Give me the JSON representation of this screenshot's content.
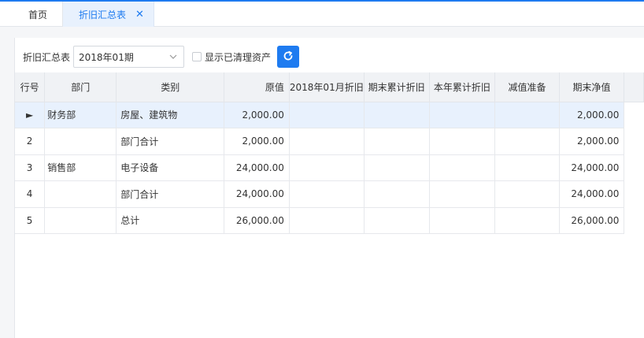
{
  "tabs": {
    "home": "首页",
    "active": "折旧汇总表",
    "close": "✕"
  },
  "toolbar": {
    "label": "折旧汇总表",
    "period": "2018年01期",
    "show_cleared_label": "显示已清理资产"
  },
  "table": {
    "headers": {
      "no": "行号",
      "dept": "部门",
      "category": "类别",
      "original": "原值",
      "period_dep": "2018年01月折旧",
      "end_accum": "期末累计折旧",
      "year_accum": "本年累计折旧",
      "impairment": "减值准备",
      "net": "期末净值"
    },
    "rows": [
      {
        "no": "►",
        "dept": "财务部",
        "category": "房屋、建筑物",
        "original": "2,000.00",
        "period_dep": "",
        "end_accum": "",
        "year_accum": "",
        "impairment": "",
        "net": "2,000.00"
      },
      {
        "no": "2",
        "dept": "",
        "category": "部门合计",
        "original": "2,000.00",
        "period_dep": "",
        "end_accum": "",
        "year_accum": "",
        "impairment": "",
        "net": "2,000.00"
      },
      {
        "no": "3",
        "dept": "销售部",
        "category": "电子设备",
        "original": "24,000.00",
        "period_dep": "",
        "end_accum": "",
        "year_accum": "",
        "impairment": "",
        "net": "24,000.00"
      },
      {
        "no": "4",
        "dept": "",
        "category": "部门合计",
        "original": "24,000.00",
        "period_dep": "",
        "end_accum": "",
        "year_accum": "",
        "impairment": "",
        "net": "24,000.00"
      },
      {
        "no": "5",
        "dept": "",
        "category": "总计",
        "original": "26,000.00",
        "period_dep": "",
        "end_accum": "",
        "year_accum": "",
        "impairment": "",
        "net": "26,000.00"
      }
    ]
  },
  "colors": {
    "accent": "#1e7bf0",
    "selected_row": "#e8f1fd",
    "header_bg": "#f0f2f5"
  }
}
